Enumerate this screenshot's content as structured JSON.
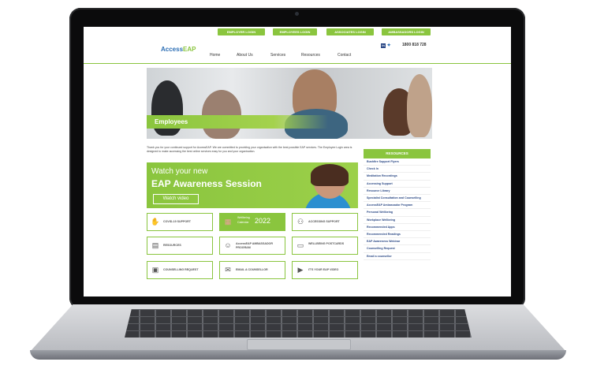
{
  "topbar": {
    "links": [
      "EMPLOYER LOGIN",
      "EMPLOYEES LOGIN",
      "ASSOCIATES LOGIN",
      "AMBASSADORS LOGIN"
    ]
  },
  "header": {
    "logo_text": "Access",
    "logo_suffix": "EAP",
    "nav": [
      "Home",
      "About Us",
      "Services",
      "Resources",
      "Contact"
    ],
    "social_icons": [
      "linkedin-icon",
      "twitter-icon"
    ],
    "phone": "1800 818 728"
  },
  "hero": {
    "title": "Employees"
  },
  "intro_text": "Thank you for your continued support for AccessEAP. We are committed to providing your organisation with the best possible EAP services. The Employee Login area is designed to make accessing the best online services easy for you and your organisation.",
  "promo": {
    "line1": "Watch your new",
    "line2": "EAP Awareness Session",
    "button": "Watch video"
  },
  "tiles": [
    {
      "label": "COVID-19 SUPPORT",
      "icon": "hands-icon"
    },
    {
      "label": "Wellbeing Calendar 2022",
      "icon": "calendar-icon"
    },
    {
      "label": "ACCESSING SUPPORT",
      "icon": "support-icon"
    },
    {
      "label": "RESOURCES",
      "icon": "resources-icon"
    },
    {
      "label": "AccessEAP AMBASSADOR PROGRAM",
      "icon": "ambassador-icon"
    },
    {
      "label": "WELLBEING POSTCARDS",
      "icon": "postcard-icon"
    },
    {
      "label": "COUNSELLING REQUEST",
      "icon": "counselling-icon"
    },
    {
      "label": "EMAIL A COUNSELLOR",
      "icon": "email-icon"
    },
    {
      "label": "IT'S YOUR EAP VIDEO",
      "icon": "play-icon"
    }
  ],
  "wellbeing_calendar": {
    "line1": "Wellbeing",
    "line2": "Calendar",
    "year": "2022"
  },
  "sidebar": {
    "heading": "RESOURCES",
    "items": [
      "Bushfire Support Flyers",
      "Check In",
      "Meditation Recordings",
      "Accessing Support",
      "Resource Library",
      "Specialist Consultation and Counselling",
      "AccessEAP Ambassador Program",
      "Personal Wellbeing",
      "Workplace Wellbeing",
      "Recommended Apps",
      "Recommended Readings",
      "EAP Awareness Webinar",
      "Counselling Request",
      "Email a counsellor"
    ]
  },
  "colors": {
    "accent": "#8ac53e",
    "link": "#2d4a86"
  }
}
